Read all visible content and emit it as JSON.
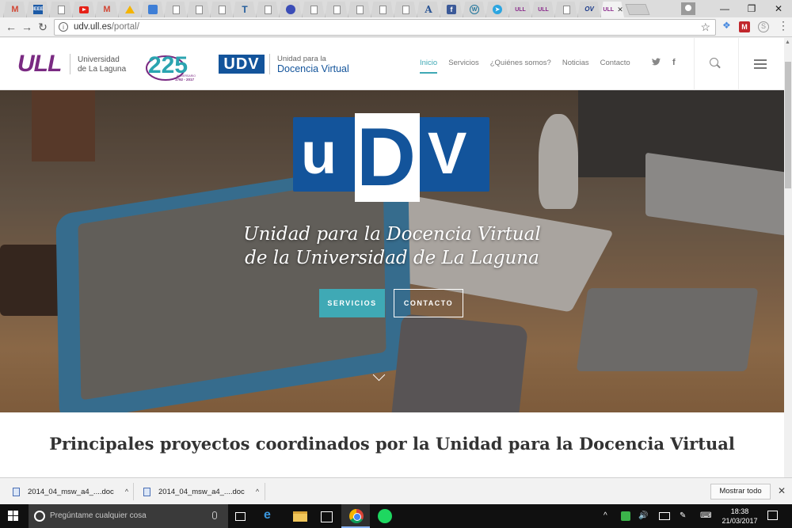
{
  "browser": {
    "tabs": [
      {
        "icon": "gmail-icon",
        "glyph": "M"
      },
      {
        "icon": "ieee-icon",
        "glyph": "IEEE"
      },
      {
        "icon": "document-icon",
        "glyph": ""
      },
      {
        "icon": "youtube-icon",
        "glyph": ""
      },
      {
        "icon": "gmail-icon",
        "glyph": "M"
      },
      {
        "icon": "drive-icon",
        "glyph": ""
      },
      {
        "icon": "calendar-icon",
        "glyph": ""
      },
      {
        "icon": "site-icon",
        "glyph": ""
      },
      {
        "icon": "site-icon",
        "glyph": ""
      },
      {
        "icon": "document-icon",
        "glyph": ""
      },
      {
        "icon": "typekit-icon",
        "glyph": "T"
      },
      {
        "icon": "document-icon",
        "glyph": ""
      },
      {
        "icon": "circle-icon",
        "glyph": ""
      },
      {
        "icon": "document-icon",
        "glyph": ""
      },
      {
        "icon": "document-icon",
        "glyph": ""
      },
      {
        "icon": "document-icon",
        "glyph": ""
      },
      {
        "icon": "document-icon",
        "glyph": ""
      },
      {
        "icon": "site-icon",
        "glyph": ""
      },
      {
        "icon": "academia-icon",
        "glyph": "A"
      },
      {
        "icon": "facebook-icon",
        "glyph": "f"
      },
      {
        "icon": "wordpress-icon",
        "glyph": "W"
      },
      {
        "icon": "telegram-icon",
        "glyph": "➤"
      },
      {
        "icon": "ull-icon",
        "glyph": "ULL"
      },
      {
        "icon": "ull-icon",
        "glyph": "ULL"
      },
      {
        "icon": "document-icon",
        "glyph": ""
      },
      {
        "icon": "ov-icon",
        "glyph": "OV"
      }
    ],
    "active_tab": {
      "glyph": "ULL",
      "close": "✕"
    },
    "window_controls": {
      "minimize": "—",
      "restore": "❐",
      "close": "✕"
    },
    "nav": {
      "back": "←",
      "forward": "→",
      "reload": "↻"
    },
    "url_host": "udv.ull.es",
    "url_path": "/portal/",
    "star": "☆",
    "extensions": {
      "dropbox": "❖",
      "m": "M",
      "skype": "S",
      "menu": "⋮"
    }
  },
  "site": {
    "ull_logo": "ULL",
    "ull_name_line1": "Universidad",
    "ull_name_line2": "de La Laguna",
    "anniversary_number": "225",
    "anniversary_label": "ANIVERSARIO",
    "anniversary_years": "1792 - 2017",
    "udv_logo": "UDV",
    "udv_name_line1": "Unidad para la",
    "udv_name_line2": "Docencia Virtual",
    "menu": [
      {
        "label": "Inicio",
        "active": true
      },
      {
        "label": "Servicios",
        "active": false
      },
      {
        "label": "¿Quiénes somos?",
        "active": false
      },
      {
        "label": "Noticias",
        "active": false
      },
      {
        "label": "Contacto",
        "active": false
      }
    ],
    "social": {
      "twitter": "🐦",
      "facebook": "f"
    }
  },
  "hero": {
    "logo_u": "u",
    "logo_d": "D",
    "logo_v": "V",
    "title_line1": "Unidad para la Docencia Virtual",
    "title_line2": "de la Universidad de La Laguna",
    "btn_services": "SERVICIOS",
    "btn_contact": "CONTACTO"
  },
  "section": {
    "title": "Principales proyectos coordinados por la Unidad para la Docencia Virtual"
  },
  "downloads": {
    "items": [
      {
        "name": "2014_04_msw_a4_....doc",
        "chevron": "^"
      },
      {
        "name": "2014_04_msw_a4_....doc",
        "chevron": "^"
      }
    ],
    "show_all": "Mostrar todo",
    "close": "✕"
  },
  "taskbar": {
    "search_placeholder": "Pregúntame cualquier cosa",
    "edge_glyph": "e",
    "tray": {
      "chevron": "^",
      "volume": "🔊",
      "keyboard": "⌨",
      "pen": "✎"
    },
    "time": "18:38",
    "date": "21/03/2017"
  },
  "colors": {
    "accent_teal": "#3fa9b5",
    "udv_blue": "#13549b",
    "ull_purple": "#7a2a82"
  }
}
